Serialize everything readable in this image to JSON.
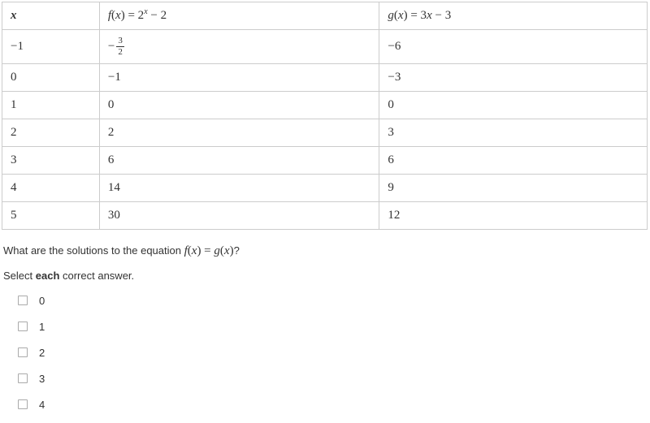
{
  "table": {
    "headers": {
      "x": "x",
      "f_prefix": "f",
      "f_open": "(",
      "f_var": "x",
      "f_close": ") = 2",
      "f_exp": "x",
      "f_tail": " − 2",
      "g_prefix": "g",
      "g_open": "(",
      "g_var": "x",
      "g_close": ") = 3",
      "g_var2": "x",
      "g_tail": " − 3"
    },
    "rows": [
      {
        "x": "−1",
        "f_is_frac": true,
        "f_sign": "−",
        "f_num": "3",
        "f_den": "2",
        "g": "−6"
      },
      {
        "x": "0",
        "f": "−1",
        "g": "−3"
      },
      {
        "x": "1",
        "f": "0",
        "g": "0"
      },
      {
        "x": "2",
        "f": "2",
        "g": "3"
      },
      {
        "x": "3",
        "f": "6",
        "g": "6"
      },
      {
        "x": "4",
        "f": "14",
        "g": "9"
      },
      {
        "x": "5",
        "f": "30",
        "g": "12"
      }
    ]
  },
  "question": {
    "pre": "What are the solutions to the equation ",
    "eq_f": "f",
    "eq_open1": "(",
    "eq_x1": "x",
    "eq_close1": ") = ",
    "eq_g": "g",
    "eq_open2": "(",
    "eq_x2": "x",
    "eq_close2": ")",
    "post": "?"
  },
  "instruction": {
    "pre": "Select ",
    "bold": "each",
    "post": " correct answer."
  },
  "options": [
    {
      "label": "0"
    },
    {
      "label": "1"
    },
    {
      "label": "2"
    },
    {
      "label": "3"
    },
    {
      "label": "4"
    }
  ],
  "chart_data": {
    "type": "table",
    "title": "Function value table for f(x)=2^x-2 and g(x)=3x-3",
    "columns": [
      "x",
      "f(x)=2^x-2",
      "g(x)=3x-3"
    ],
    "rows": [
      [
        -1,
        -1.5,
        -6
      ],
      [
        0,
        -1,
        -3
      ],
      [
        1,
        0,
        0
      ],
      [
        2,
        2,
        3
      ],
      [
        3,
        6,
        6
      ],
      [
        4,
        14,
        9
      ],
      [
        5,
        30,
        12
      ]
    ],
    "question": "What are the solutions to the equation f(x) = g(x)?",
    "answer_choices": [
      0,
      1,
      2,
      3,
      4
    ]
  }
}
